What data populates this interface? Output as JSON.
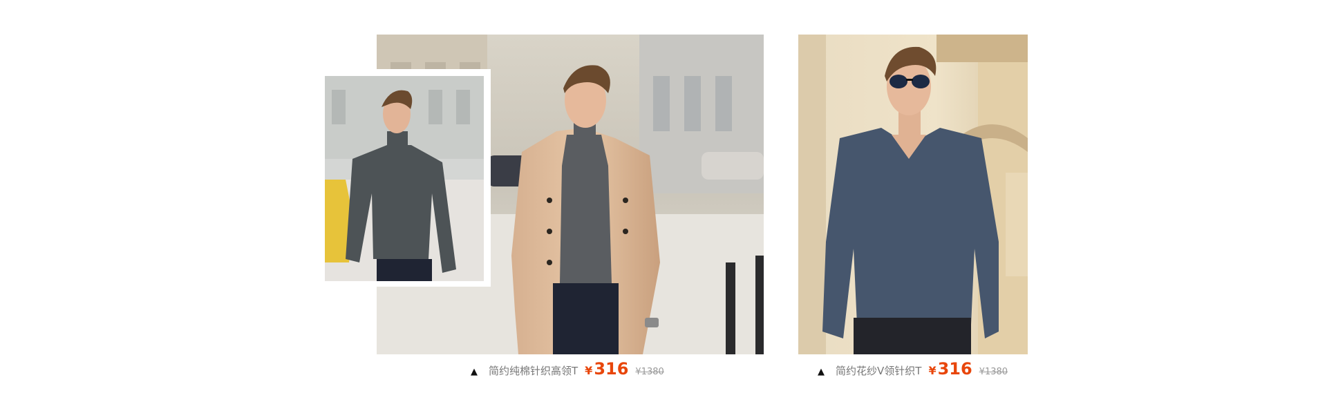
{
  "products": [
    {
      "name": "简约纯棉针织高领T",
      "currency": "¥",
      "price": "316",
      "original_price": "¥1380",
      "bullet_icon": "triangle-up-icon",
      "colors": {
        "price": "#e8460b",
        "name": "#777777",
        "old_price": "#999999"
      }
    },
    {
      "name": "简约花纱V领针织T",
      "currency": "¥",
      "price": "316",
      "original_price": "¥1380",
      "bullet_icon": "triangle-up-icon",
      "colors": {
        "price": "#e8460b",
        "name": "#777777",
        "old_price": "#999999"
      }
    }
  ]
}
